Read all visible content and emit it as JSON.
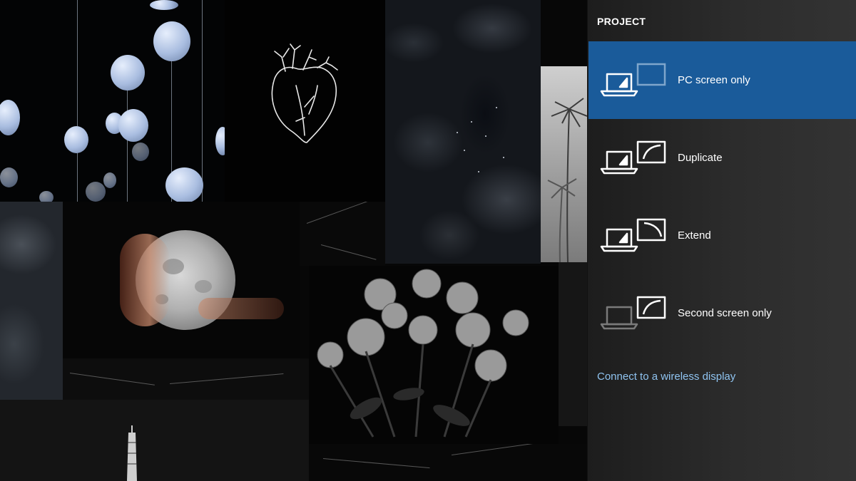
{
  "panel": {
    "title": "PROJECT",
    "options": [
      {
        "label": "PC screen only",
        "icon": "pc-screen-only-icon",
        "selected": true
      },
      {
        "label": "Duplicate",
        "icon": "duplicate-icon",
        "selected": false
      },
      {
        "label": "Extend",
        "icon": "extend-icon",
        "selected": false
      },
      {
        "label": "Second screen only",
        "icon": "second-screen-only-icon",
        "selected": false
      }
    ],
    "wireless_link": "Connect to a wireless display"
  },
  "colors": {
    "accent": "#1a5b9a",
    "link": "#8fc3f0",
    "panel_bg": "#2c2c2c"
  }
}
